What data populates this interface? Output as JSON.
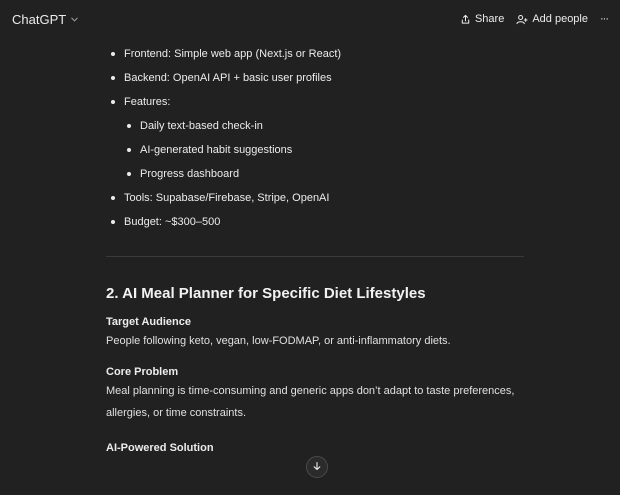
{
  "header": {
    "model_label": "ChatGPT",
    "share_label": "Share",
    "add_people_label": "Add people",
    "more_label": "···"
  },
  "plan": {
    "items": [
      {
        "text": "Frontend: Simple web app (Next.js or React)"
      },
      {
        "text": "Backend: OpenAI API + basic user profiles"
      },
      {
        "text": "Features:"
      }
    ],
    "features": [
      {
        "text": "Daily text-based check-in"
      },
      {
        "text": "AI-generated habit suggestions"
      },
      {
        "text": "Progress dashboard"
      }
    ],
    "items_after": [
      {
        "text": "Tools: Supabase/Firebase, Stripe, OpenAI"
      },
      {
        "text": "Budget: ~$300–500"
      }
    ]
  },
  "section2": {
    "title": "2. AI Meal Planner for Specific Diet Lifestyles",
    "target_label": "Target Audience",
    "target_text": "People following keto, vegan, low-FODMAP, or anti-inflammatory diets.",
    "problem_label": "Core Problem",
    "problem_text": "Meal planning is time-consuming and generic apps don’t adapt to taste preferences, allergies, or time constraints.",
    "solution_label": "AI-Powered Solution"
  },
  "colors": {
    "background": "#212121",
    "text": "#ececec",
    "divider": "#3a3a3a"
  }
}
